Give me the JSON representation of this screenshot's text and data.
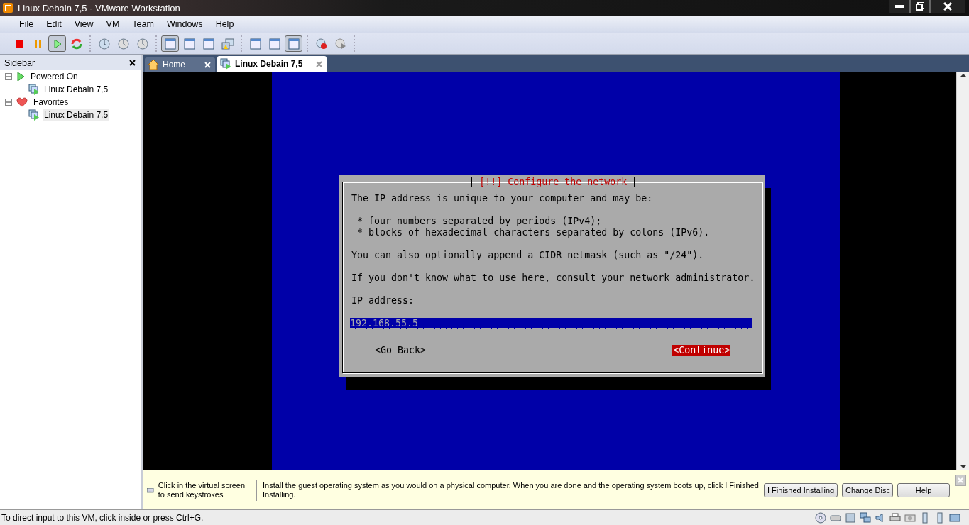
{
  "window": {
    "title": "Linux Debain 7,5 - VMware Workstation"
  },
  "menu": [
    "File",
    "Edit",
    "View",
    "VM",
    "Team",
    "Windows",
    "Help"
  ],
  "toolbar": {
    "groups": [
      [
        {
          "kind": "stop",
          "pressed": false
        },
        {
          "kind": "pause",
          "pressed": false
        },
        {
          "kind": "play",
          "pressed": true
        },
        {
          "kind": "reset",
          "pressed": false
        }
      ],
      [
        {
          "kind": "snapshot",
          "pressed": false
        },
        {
          "kind": "revert",
          "pressed": false
        },
        {
          "kind": "manager",
          "pressed": false
        }
      ],
      [
        {
          "kind": "sidebar",
          "pressed": true
        },
        {
          "kind": "fit",
          "pressed": false
        },
        {
          "kind": "fullscreen",
          "pressed": false
        },
        {
          "kind": "unity",
          "pressed": false
        }
      ],
      [
        {
          "kind": "console",
          "pressed": false
        },
        {
          "kind": "summary",
          "pressed": false
        },
        {
          "kind": "thumbnail",
          "pressed": true
        }
      ],
      [
        {
          "kind": "record",
          "pressed": false
        },
        {
          "kind": "replay",
          "pressed": false
        }
      ]
    ]
  },
  "sidebar": {
    "title": "Sidebar",
    "tree": [
      {
        "label": "Powered On",
        "kind": "powered",
        "expanded": true,
        "children": [
          {
            "label": "Linux Debain 7,5",
            "selected": false
          }
        ]
      },
      {
        "label": "Favorites",
        "kind": "favorites",
        "expanded": true,
        "children": [
          {
            "label": "Linux Debain 7,5",
            "selected": true
          }
        ]
      }
    ]
  },
  "tabs": [
    {
      "label": "Home",
      "kind": "home",
      "selected": false
    },
    {
      "label": "Linux Debain 7,5",
      "kind": "vm",
      "selected": true
    }
  ],
  "installer": {
    "title": "[!!] Configure the network",
    "paragraphs": [
      {
        "kind": "text",
        "text": "The IP address is unique to your computer and may be:"
      },
      {
        "kind": "bullets",
        "items": [
          " * four numbers separated by periods (IPv4);",
          " * blocks of hexadecimal characters separated by colons (IPv6)."
        ]
      },
      {
        "kind": "text",
        "text": "You can also optionally append a CIDR netmask (such as \"/24\")."
      },
      {
        "kind": "text",
        "text": "If you don't know what to use here, consult your network administrator."
      }
    ],
    "field_label": "IP address:",
    "field_value": "192.168.55.5",
    "buttons": [
      {
        "label": "<Go Back>",
        "selected": false
      },
      {
        "label": "<Continue>",
        "selected": true
      }
    ]
  },
  "hint_bar": {
    "tip": "Click in the virtual screen to send keystrokes",
    "message": "Install the guest operating system as you would on a physical computer. When you are done and the operating system boots up, click I Finished Installing.",
    "buttons": [
      "I Finished Installing",
      "Change Disc",
      "Help"
    ]
  },
  "status_bar": {
    "text": "To direct input to this VM, click inside or press Ctrl+G."
  }
}
